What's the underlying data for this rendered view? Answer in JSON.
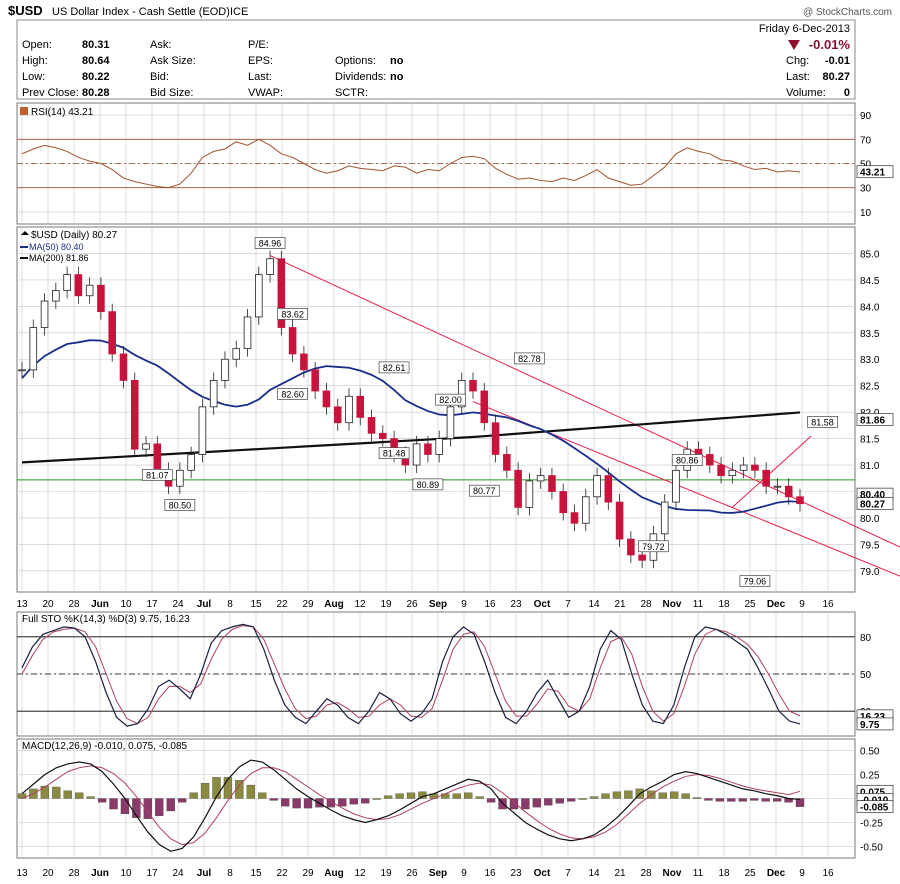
{
  "header": {
    "symbol": "$USD",
    "name": "US Dollar Index - Cash Settle (EOD)",
    "exchange": "ICE",
    "watermark": "@ StockCharts.com",
    "date": "Friday  6-Dec-2013",
    "change_pct": "-0.01%",
    "quote_fields": [
      {
        "label": "Open:",
        "value": "80.31"
      },
      {
        "label": "High:",
        "value": "80.64"
      },
      {
        "label": "Low:",
        "value": "80.22"
      },
      {
        "label": "Prev Close:",
        "value": "80.28"
      }
    ],
    "mid_labels": [
      "Ask:",
      "Ask Size:",
      "Bid:",
      "Bid Size:"
    ],
    "mid2_labels": [
      "P/E:",
      "EPS:",
      "Last:",
      "VWAP:"
    ],
    "mid3_fields": [
      {
        "label": "Options:",
        "value": "no"
      },
      {
        "label": "Dividends:",
        "value": "no"
      },
      {
        "label": "SCTR:",
        "value": ""
      }
    ],
    "right_fields": [
      {
        "label": "Chg:",
        "value": "-0.01"
      },
      {
        "label": "Last:",
        "value": "80.27"
      },
      {
        "label": "Volume:",
        "value": "0"
      }
    ]
  },
  "colors": {
    "up": "#ffffff",
    "down": "#c8143c",
    "ma50": "#1a2d8c",
    "ma200": "#111111",
    "rsi": "#a0522d",
    "trend": "#e8204a",
    "support": "#1e9a1e",
    "macd_bar": "#8a8a40",
    "macd_bar_neg": "#8a3a6a",
    "grid": "#c8c8c8"
  },
  "chart_data": {
    "type": "candlestick",
    "x_tick_labels": [
      "13",
      "20",
      "28",
      "Jun",
      "10",
      "17",
      "24",
      "Jul",
      "8",
      "15",
      "22",
      "29",
      "Aug",
      "12",
      "19",
      "26",
      "Sep",
      "9",
      "16",
      "23",
      "Oct",
      "7",
      "14",
      "21",
      "28",
      "Nov",
      "11",
      "18",
      "25",
      "Dec",
      "9",
      "16"
    ],
    "rsi": {
      "legend": "RSI(14) 43.21",
      "current_label": "43.21",
      "ticks": [
        "90",
        "70",
        "50",
        "30",
        "10"
      ],
      "tick_values": [
        90,
        70,
        50,
        30,
        10
      ],
      "values": [
        58,
        62,
        65,
        63,
        60,
        55,
        52,
        50,
        45,
        38,
        35,
        33,
        31,
        30,
        33,
        42,
        55,
        60,
        62,
        68,
        65,
        70,
        65,
        58,
        55,
        50,
        45,
        42,
        44,
        48,
        46,
        45,
        44,
        48,
        47,
        42,
        45,
        44,
        50,
        55,
        56,
        54,
        46,
        41,
        37,
        38,
        36,
        35,
        38,
        36,
        40,
        45,
        38,
        35,
        32,
        33,
        40,
        47,
        58,
        63,
        60,
        58,
        53,
        52,
        48,
        45,
        46,
        43,
        44,
        43
      ]
    },
    "price": {
      "legend": "$USD (Daily) 80.27",
      "ma50_legend": "MA(50) 80.40",
      "ma200_legend": "MA(200) 81.86",
      "ylim": [
        78.6,
        85.5
      ],
      "ticks": [
        "85.0",
        "84.5",
        "84.0",
        "83.5",
        "83.0",
        "82.5",
        "82.0",
        "81.5",
        "81.0",
        "80.5",
        "80.0",
        "79.5",
        "79.0"
      ],
      "tick_values": [
        85.0,
        84.5,
        84.0,
        83.5,
        83.0,
        82.5,
        82.0,
        81.5,
        81.0,
        80.5,
        80.0,
        79.5,
        79.0
      ],
      "right_labels": [
        {
          "text": "81.86",
          "value": 81.86
        },
        {
          "text": "80.40",
          "value": 80.45
        },
        {
          "text": "80.27",
          "value": 80.27
        }
      ],
      "support_level": 80.72,
      "close": [
        82.8,
        83.6,
        84.1,
        84.3,
        84.6,
        84.2,
        84.4,
        83.9,
        83.1,
        82.6,
        81.3,
        81.4,
        80.9,
        80.6,
        80.9,
        81.2,
        82.1,
        82.6,
        83.0,
        83.2,
        83.8,
        84.6,
        84.9,
        83.6,
        83.1,
        82.8,
        82.4,
        82.1,
        81.8,
        82.3,
        81.9,
        81.6,
        81.5,
        81.2,
        81.0,
        81.4,
        81.2,
        81.5,
        82.1,
        82.6,
        82.4,
        81.8,
        81.2,
        80.9,
        80.2,
        80.7,
        80.8,
        80.5,
        80.1,
        79.9,
        80.4,
        80.8,
        80.3,
        79.6,
        79.3,
        79.2,
        79.7,
        80.3,
        80.9,
        81.3,
        81.2,
        81.0,
        80.8,
        80.9,
        81.0,
        80.9,
        80.6,
        80.6,
        80.4,
        80.27
      ],
      "annotations": [
        {
          "text": "84.96",
          "index": 22,
          "value": 84.96,
          "pos": "above"
        },
        {
          "text": "83.62",
          "index": 24,
          "value": 83.62,
          "pos": "above"
        },
        {
          "text": "82.60",
          "index": 24,
          "value": 82.6,
          "pos": "below"
        },
        {
          "text": "82.61",
          "index": 33,
          "value": 82.61,
          "pos": "above"
        },
        {
          "text": "81.48",
          "index": 33,
          "value": 81.48,
          "pos": "below"
        },
        {
          "text": "82.00",
          "index": 38,
          "value": 82.0,
          "pos": "above"
        },
        {
          "text": "80.89",
          "index": 36,
          "value": 80.89,
          "pos": "below"
        },
        {
          "text": "80.77",
          "index": 41,
          "value": 80.77,
          "pos": "below"
        },
        {
          "text": "82.78",
          "index": 45,
          "value": 82.78,
          "pos": "above"
        },
        {
          "text": "81.07",
          "index": 12,
          "value": 81.07,
          "pos": "below"
        },
        {
          "text": "80.50",
          "index": 14,
          "value": 80.5,
          "pos": "below"
        },
        {
          "text": "80.86",
          "index": 59,
          "value": 80.86,
          "pos": "above"
        },
        {
          "text": "79.72",
          "index": 56,
          "value": 79.72,
          "pos": "below"
        },
        {
          "text": "79.06",
          "index": 65,
          "value": 79.06,
          "pos": "below"
        },
        {
          "text": "81.58",
          "index": 71,
          "value": 81.58,
          "pos": "above"
        }
      ]
    },
    "sto": {
      "legend": "Full STO %K(14,3) %D(3) 9.75, 16.23",
      "ticks": [
        "80",
        "50",
        "20"
      ],
      "tick_values": [
        80,
        50,
        20
      ],
      "right_labels": [
        {
          "text": "16.23",
          "value": 16.23
        },
        {
          "text": "9.75",
          "value": 9.75
        }
      ],
      "k": [
        55,
        72,
        82,
        85,
        88,
        87,
        80,
        60,
        35,
        15,
        8,
        10,
        22,
        40,
        45,
        38,
        30,
        50,
        75,
        85,
        88,
        90,
        88,
        70,
        45,
        25,
        15,
        10,
        20,
        30,
        25,
        15,
        10,
        20,
        35,
        30,
        18,
        12,
        18,
        30,
        60,
        80,
        88,
        82,
        60,
        35,
        15,
        10,
        20,
        35,
        45,
        30,
        15,
        20,
        40,
        70,
        85,
        78,
        50,
        25,
        12,
        10,
        25,
        55,
        80,
        88,
        86,
        82,
        76,
        70,
        55,
        38,
        20,
        12,
        9.75
      ],
      "d": [
        50,
        65,
        78,
        84,
        86,
        87,
        84,
        72,
        50,
        28,
        14,
        10,
        15,
        30,
        40,
        40,
        35,
        42,
        62,
        78,
        86,
        89,
        88,
        78,
        58,
        38,
        22,
        14,
        16,
        25,
        27,
        22,
        15,
        16,
        25,
        30,
        25,
        16,
        15,
        22,
        45,
        70,
        82,
        84,
        72,
        50,
        28,
        16,
        16,
        26,
        38,
        36,
        24,
        20,
        30,
        55,
        76,
        80,
        66,
        40,
        20,
        12,
        18,
        40,
        66,
        82,
        86,
        84,
        80,
        74,
        64,
        50,
        34,
        20,
        16.23
      ]
    },
    "macd": {
      "legend": "MACD(12,26,9) -0.010, 0.075, -0.085",
      "ticks": [
        "0.50",
        "0.25",
        "0.00",
        "-0.25",
        "-0.50"
      ],
      "tick_values": [
        0.5,
        0.25,
        0.0,
        -0.25,
        -0.5
      ],
      "right_labels": [
        {
          "text": "0.075",
          "value": 0.075
        },
        {
          "text": "-0.010",
          "value": -0.01
        },
        {
          "text": "-0.085",
          "value": -0.085
        }
      ],
      "macd": [
        0.05,
        0.15,
        0.25,
        0.32,
        0.36,
        0.38,
        0.36,
        0.28,
        0.15,
        0.0,
        -0.18,
        -0.35,
        -0.48,
        -0.55,
        -0.52,
        -0.4,
        -0.2,
        0.02,
        0.2,
        0.33,
        0.4,
        0.38,
        0.3,
        0.2,
        0.1,
        0.02,
        -0.05,
        -0.12,
        -0.18,
        -0.22,
        -0.25,
        -0.22,
        -0.18,
        -0.12,
        -0.05,
        0.02,
        0.05,
        0.1,
        0.15,
        0.2,
        0.18,
        0.1,
        -0.05,
        -0.15,
        -0.25,
        -0.32,
        -0.38,
        -0.42,
        -0.44,
        -0.42,
        -0.38,
        -0.3,
        -0.2,
        -0.08,
        0.05,
        0.12,
        0.18,
        0.25,
        0.28,
        0.26,
        0.22,
        0.18,
        0.14,
        0.1,
        0.08,
        0.05,
        0.03,
        0.0,
        -0.01
      ],
      "signal": [
        0.0,
        0.05,
        0.12,
        0.2,
        0.28,
        0.32,
        0.34,
        0.32,
        0.26,
        0.16,
        0.02,
        -0.14,
        -0.3,
        -0.42,
        -0.48,
        -0.46,
        -0.36,
        -0.2,
        -0.02,
        0.14,
        0.26,
        0.32,
        0.32,
        0.28,
        0.2,
        0.12,
        0.04,
        -0.03,
        -0.1,
        -0.16,
        -0.2,
        -0.22,
        -0.21,
        -0.17,
        -0.11,
        -0.05,
        0.0,
        0.05,
        0.1,
        0.14,
        0.16,
        0.14,
        0.06,
        -0.04,
        -0.14,
        -0.23,
        -0.31,
        -0.37,
        -0.41,
        -0.42,
        -0.4,
        -0.35,
        -0.27,
        -0.16,
        -0.05,
        0.04,
        0.12,
        0.18,
        0.23,
        0.25,
        0.24,
        0.21,
        0.17,
        0.13,
        0.1,
        0.08,
        0.06,
        0.04,
        0.075
      ],
      "hist": [
        0.05,
        0.1,
        0.13,
        0.12,
        0.08,
        0.06,
        0.02,
        -0.04,
        -0.11,
        -0.16,
        -0.2,
        -0.21,
        -0.18,
        -0.13,
        -0.04,
        0.06,
        0.16,
        0.22,
        0.22,
        0.19,
        0.14,
        0.06,
        -0.02,
        -0.08,
        -0.1,
        -0.1,
        -0.09,
        -0.09,
        -0.08,
        -0.06,
        -0.05,
        0.0,
        0.03,
        0.05,
        0.06,
        0.07,
        0.05,
        0.05,
        0.05,
        0.06,
        0.02,
        -0.04,
        -0.11,
        -0.11,
        -0.11,
        -0.09,
        -0.07,
        -0.05,
        -0.03,
        0.0,
        0.02,
        0.05,
        0.07,
        0.08,
        0.1,
        0.08,
        0.06,
        0.07,
        0.05,
        0.01,
        -0.02,
        -0.03,
        -0.03,
        -0.03,
        -0.02,
        -0.03,
        -0.03,
        -0.04,
        -0.085
      ]
    }
  }
}
